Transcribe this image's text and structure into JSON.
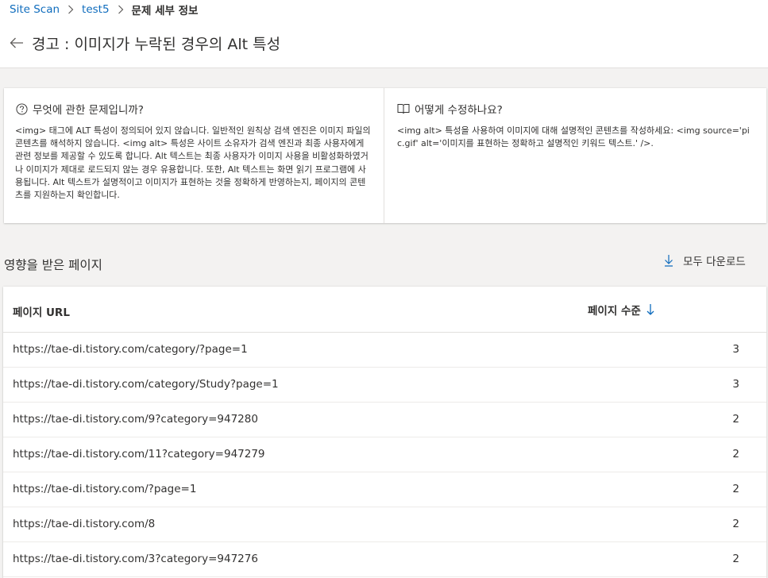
{
  "breadcrumb": {
    "items": [
      "Site Scan",
      "test5"
    ],
    "current": "문제 세부 정보"
  },
  "header": {
    "title": "경고 : 이미지가 누락된 경우의 Alt 특성",
    "back_icon": "arrow-left-icon"
  },
  "info": {
    "what": {
      "icon": "question-circle-icon",
      "heading": "무엇에 관한 문제입니까?",
      "body": "<img> 태그에 ALT 특성이 정의되어 있지 않습니다. 일반적인 원칙상 검색 엔진은 이미지 파일의 콘텐츠를 해석하지 않습니다. <img alt> 특성은 사이트 소유자가 검색 엔진과 최종 사용자에게 관련 정보를 제공할 수 있도록 합니다. Alt 텍스트는 최종 사용자가 이미지 사용을 비활성화하였거나 이미지가 제대로 로드되지 않는 경우 유용합니다. 또한, Alt 텍스트는 화면 읽기 프로그램에 사용됩니다. Alt 텍스트가 설명적이고 이미지가 표현하는 것을 정확하게 반영하는지, 페이지의 콘텐츠를 지원하는지 확인합니다."
    },
    "how": {
      "icon": "book-icon",
      "heading": "어떻게 수정하나요?",
      "body": "<img alt> 특성을 사용하여 이미지에 대해 설명적인 콘텐츠를 작성하세요: <img source='pic.gif' alt='이미지를 표현하는 정확하고 설명적인 키워드 텍스트.' />."
    }
  },
  "affected": {
    "title": "영향을 받은 페이지",
    "download_label": "모두 다운로드",
    "download_icon": "download-icon"
  },
  "table": {
    "col_url": "페이지 URL",
    "col_level": "페이지 수준",
    "sort_icon": "sort-descending-icon",
    "rows": [
      {
        "url": "https://tae-di.tistory.com/category/?page=1",
        "level": "3"
      },
      {
        "url": "https://tae-di.tistory.com/category/Study?page=1",
        "level": "3"
      },
      {
        "url": "https://tae-di.tistory.com/9?category=947280",
        "level": "2"
      },
      {
        "url": "https://tae-di.tistory.com/11?category=947279",
        "level": "2"
      },
      {
        "url": "https://tae-di.tistory.com/?page=1",
        "level": "2"
      },
      {
        "url": "https://tae-di.tistory.com/8",
        "level": "2"
      },
      {
        "url": "https://tae-di.tistory.com/3?category=947276",
        "level": "2"
      }
    ]
  },
  "colors": {
    "accent": "#0f6cbd",
    "text": "#323130",
    "page_bg": "#f3f2f1",
    "card_bg": "#ffffff"
  }
}
